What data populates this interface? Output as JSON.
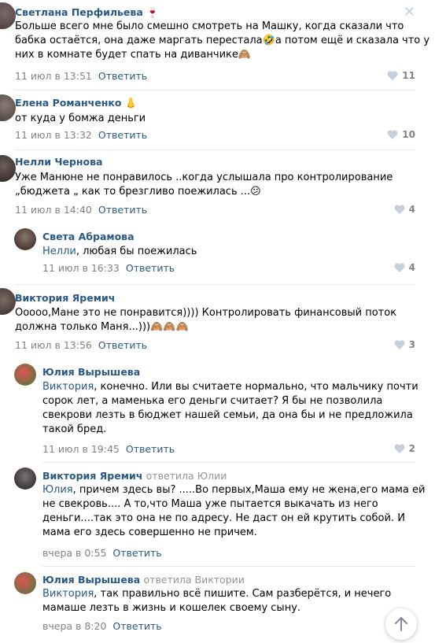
{
  "comments": [
    {
      "name": "Светлана Перфильева",
      "badge": "🍷",
      "lines": [
        "Больше всего мне было смешно смотреть на Машку, когда сказали что",
        "бабка остаётся, она даже маргать перестала🤣а потом ещё и сказала что у",
        "них в комнате будет спать на диванчике🙈"
      ],
      "date": "11 июл в 13:51",
      "reply_label": "Ответить",
      "likes": "11"
    },
    {
      "name": "Елена Романченко",
      "badge": "👃",
      "lines": [
        "от куда у бомжа деньги"
      ],
      "date": "11 июл в 13:32",
      "reply_label": "Ответить",
      "likes": "10"
    },
    {
      "name": "Нелли Чернова",
      "lines": [
        "Уже Манюне не понравилось ..когда услышала про контролирование",
        "„бюджета „ как то брезгливо поежилась ...😕"
      ],
      "date": "11 июл в 14:40",
      "reply_label": "Ответить",
      "likes": "4"
    },
    {
      "name": "Света Абрамова",
      "mention": "Нелли",
      "lines": [
        ", любая бы поежилась"
      ],
      "date": "11 июл в 16:33",
      "reply_label": "Ответить",
      "likes": "4"
    },
    {
      "name": "Виктория Яремич",
      "lines": [
        "Оoooo,Мане это не понравится)))) Контролировать финансовый поток",
        "должна только Маня...)))🙈🙈🙈"
      ],
      "date": "11 июл в 13:56",
      "reply_label": "Ответить",
      "likes": "3"
    },
    {
      "name": "Юлия Вырышева",
      "mention": "Виктория",
      "lines": [
        ", конечно. Или вы считаете нормально, что мальчику почти",
        "сорок лет, а маменька его деньги считает? Я бы не позволила",
        "свекрови лезть в бюджет нашей семьи, да она бы и не предложила",
        "такой бред."
      ],
      "date": "11 июл в 19:45",
      "reply_label": "Ответить",
      "likes": "2"
    },
    {
      "name": "Виктория Яремич",
      "reply_to": "ответила Юлии",
      "mention": "Юлия",
      "lines": [
        ", причем здесь вы? .....Во первых,Маша ему не жена,его мама ей",
        "не свекровь.... А то,что Маша уже пытается выкачать из него",
        "деньги....так это она не по адресу. Не даст он ей крутить собой. И",
        "мама его здесь совершенно не причем."
      ],
      "date": "вчера в 0:55",
      "reply_label": "Ответить"
    },
    {
      "name": "Юлия Вырышева",
      "reply_to": "ответила Виктории",
      "mention": "Виктория",
      "lines": [
        ", так правильно всё пишите. Сам разберётся, и нечего",
        "мамаше лезть в жизнь и кошелек своему сыну."
      ],
      "date": "вчера в 8:20",
      "reply_label": "Ответить"
    }
  ],
  "icons": {
    "close": "close-icon",
    "like": "heart-icon",
    "scroll": "arrow-up-icon"
  },
  "colors": {
    "link": "#2a5885",
    "meta": "#828282",
    "separator": "#e7e8ec"
  }
}
